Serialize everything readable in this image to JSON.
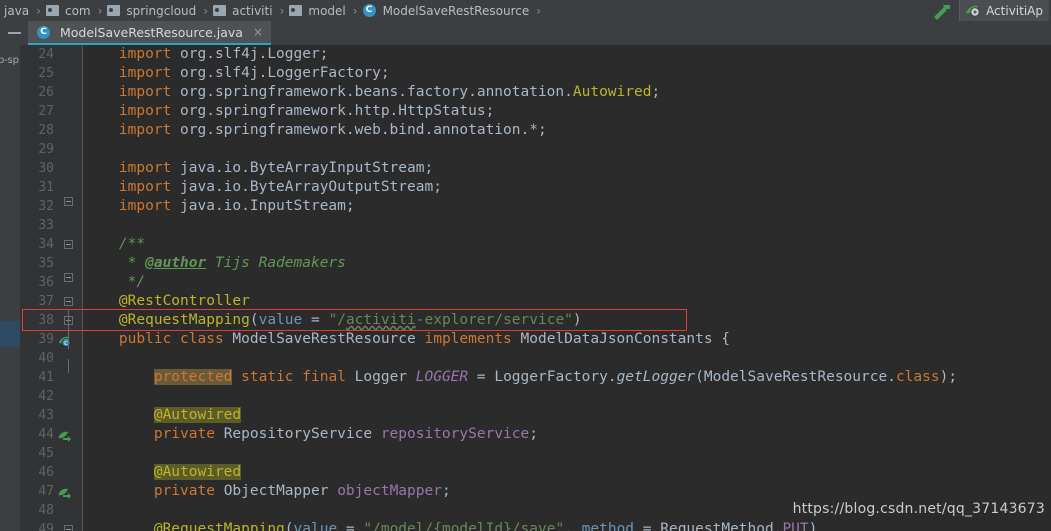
{
  "window": {
    "theme_bg": "#2b2b2b",
    "chrome_bg": "#3c3f41",
    "accent": "#2aa5c4"
  },
  "navbar": {
    "crumbs": [
      {
        "label": "java",
        "icon": "none"
      },
      {
        "label": "com",
        "icon": "folder-icon"
      },
      {
        "label": "springcloud",
        "icon": "folder-icon"
      },
      {
        "label": "activiti",
        "icon": "folder-icon"
      },
      {
        "label": "model",
        "icon": "folder-icon"
      },
      {
        "label": "ModelSaveRestResource",
        "icon": "class-icon"
      }
    ],
    "separator": "›",
    "build_icon": "hammer-icon",
    "run_config": {
      "label": "ActivitiAp",
      "icon": "run-config-icon"
    }
  },
  "tabbar": {
    "collapse_label": "—",
    "tabs": [
      {
        "label": "ModelSaveRestResource.java",
        "icon": "class-icon",
        "close": "×",
        "active": true
      }
    ]
  },
  "toolstrip": {
    "label": "p-sp"
  },
  "editor": {
    "first_line": 24,
    "lines": [
      {
        "n": 24,
        "tokens": [
          {
            "t": "    ",
            "c": "plain"
          },
          {
            "t": "import ",
            "c": "kw"
          },
          {
            "t": "org.slf4j.Logger;",
            "c": "plain"
          }
        ]
      },
      {
        "n": 25,
        "tokens": [
          {
            "t": "    ",
            "c": "plain"
          },
          {
            "t": "import ",
            "c": "kw"
          },
          {
            "t": "org.slf4j.LoggerFactory;",
            "c": "plain"
          }
        ]
      },
      {
        "n": 26,
        "tokens": [
          {
            "t": "    ",
            "c": "plain"
          },
          {
            "t": "import ",
            "c": "kw"
          },
          {
            "t": "org.springframework.beans.factory.annotation.",
            "c": "plain"
          },
          {
            "t": "Autowired",
            "c": "ann"
          },
          {
            "t": ";",
            "c": "plain"
          }
        ]
      },
      {
        "n": 27,
        "tokens": [
          {
            "t": "    ",
            "c": "plain"
          },
          {
            "t": "import ",
            "c": "kw"
          },
          {
            "t": "org.springframework.http.HttpStatus;",
            "c": "plain"
          }
        ]
      },
      {
        "n": 28,
        "tokens": [
          {
            "t": "    ",
            "c": "plain"
          },
          {
            "t": "import ",
            "c": "kw"
          },
          {
            "t": "org.springframework.web.bind.annotation.*;",
            "c": "plain"
          }
        ]
      },
      {
        "n": 29,
        "tokens": []
      },
      {
        "n": 30,
        "tokens": [
          {
            "t": "    ",
            "c": "plain"
          },
          {
            "t": "import ",
            "c": "kw"
          },
          {
            "t": "java.io.ByteArrayInputStream;",
            "c": "plain"
          }
        ]
      },
      {
        "n": 31,
        "tokens": [
          {
            "t": "    ",
            "c": "plain"
          },
          {
            "t": "import ",
            "c": "kw"
          },
          {
            "t": "java.io.ByteArrayOutputStream;",
            "c": "plain"
          }
        ]
      },
      {
        "n": 32,
        "tokens": [
          {
            "t": "    ",
            "c": "plain"
          },
          {
            "t": "import ",
            "c": "kw"
          },
          {
            "t": "java.io.InputStream;",
            "c": "plain"
          }
        ]
      },
      {
        "n": 33,
        "tokens": []
      },
      {
        "n": 34,
        "tokens": [
          {
            "t": "    ",
            "c": "plain"
          },
          {
            "t": "/**",
            "c": "cmtdoc"
          }
        ]
      },
      {
        "n": 35,
        "tokens": [
          {
            "t": "     * ",
            "c": "cmtdoc"
          },
          {
            "t": "@author",
            "c": "tagdoc"
          },
          {
            "t": " Tijs Rademakers",
            "c": "cmtdoc"
          }
        ]
      },
      {
        "n": 36,
        "tokens": [
          {
            "t": "     */",
            "c": "cmtdoc"
          }
        ]
      },
      {
        "n": 37,
        "tokens": [
          {
            "t": "    ",
            "c": "plain"
          },
          {
            "t": "@RestController",
            "c": "ann"
          }
        ]
      },
      {
        "n": 38,
        "tokens": [
          {
            "t": "    ",
            "c": "plain"
          },
          {
            "t": "@RequestMapping",
            "c": "ann"
          },
          {
            "t": "(",
            "c": "plain"
          },
          {
            "t": "value",
            "c": "num"
          },
          {
            "t": " = ",
            "c": "plain"
          },
          {
            "t": "\"/",
            "c": "str"
          },
          {
            "t": "activiti",
            "c": "typo"
          },
          {
            "t": "-explorer/service\"",
            "c": "str"
          },
          {
            "t": ")",
            "c": "plain"
          }
        ]
      },
      {
        "n": 39,
        "tokens": [
          {
            "t": "    ",
            "c": "plain"
          },
          {
            "t": "public class ",
            "c": "kw"
          },
          {
            "t": "ModelSaveRestResource ",
            "c": "plain"
          },
          {
            "t": "implements ",
            "c": "kw"
          },
          {
            "t": "ModelDataJsonConstants {",
            "c": "plain"
          }
        ]
      },
      {
        "n": 40,
        "tokens": []
      },
      {
        "n": 41,
        "tokens": [
          {
            "t": "        ",
            "c": "plain"
          },
          {
            "t": "protected",
            "c": "srchhl"
          },
          {
            "t": " ",
            "c": "plain"
          },
          {
            "t": "static final ",
            "c": "kw"
          },
          {
            "t": "Logger ",
            "c": "plain"
          },
          {
            "t": "LOGGER",
            "c": "constf"
          },
          {
            "t": " = LoggerFactory.",
            "c": "plain"
          },
          {
            "t": "getLogger",
            "c": "meth"
          },
          {
            "t": "(ModelSaveRestResource.",
            "c": "plain"
          },
          {
            "t": "class",
            "c": "kw"
          },
          {
            "t": ");",
            "c": "plain"
          }
        ]
      },
      {
        "n": 42,
        "tokens": []
      },
      {
        "n": 43,
        "tokens": [
          {
            "t": "        ",
            "c": "plain"
          },
          {
            "t": "@Autowired",
            "c": "annhl"
          }
        ]
      },
      {
        "n": 44,
        "tokens": [
          {
            "t": "        ",
            "c": "plain"
          },
          {
            "t": "private ",
            "c": "kw"
          },
          {
            "t": "RepositoryService ",
            "c": "plain"
          },
          {
            "t": "repositoryService",
            "c": "field"
          },
          {
            "t": ";",
            "c": "plain"
          }
        ]
      },
      {
        "n": 45,
        "tokens": []
      },
      {
        "n": 46,
        "tokens": [
          {
            "t": "        ",
            "c": "plain"
          },
          {
            "t": "@Autowired",
            "c": "annhl"
          }
        ]
      },
      {
        "n": 47,
        "tokens": [
          {
            "t": "        ",
            "c": "plain"
          },
          {
            "t": "private ",
            "c": "kw"
          },
          {
            "t": "ObjectMapper ",
            "c": "plain"
          },
          {
            "t": "objectMapper",
            "c": "field"
          },
          {
            "t": ";",
            "c": "plain"
          }
        ]
      },
      {
        "n": 48,
        "tokens": []
      },
      {
        "n": 49,
        "tokens": [
          {
            "t": "        ",
            "c": "plain"
          },
          {
            "t": "@RequestMapping",
            "c": "ann"
          },
          {
            "t": "(",
            "c": "plain"
          },
          {
            "t": "value",
            "c": "num"
          },
          {
            "t": " = ",
            "c": "plain"
          },
          {
            "t": "\"/model/{modelId}/save\"",
            "c": "str"
          },
          {
            "t": ", ",
            "c": "plain"
          },
          {
            "t": "method",
            "c": "num"
          },
          {
            "t": " = RequestMethod.",
            "c": "plain"
          },
          {
            "t": "PUT",
            "c": "field"
          },
          {
            "t": ")",
            "c": "plain"
          }
        ]
      }
    ],
    "gutter_icons": [
      {
        "line": 39,
        "icon": "class-override-icon"
      },
      {
        "line": 44,
        "icon": "bean-injection-icon"
      },
      {
        "line": 47,
        "icon": "bean-injection-icon"
      }
    ],
    "fold_markers": [
      {
        "line": 32,
        "type": "collapse-end"
      },
      {
        "line": 34,
        "type": "collapse-start"
      },
      {
        "line": 36,
        "type": "collapse-end"
      },
      {
        "line": 37,
        "type": "collapse-start"
      },
      {
        "line": 38,
        "type": "collapse-start"
      },
      {
        "line": 49,
        "type": "collapse-start"
      }
    ]
  },
  "annotation": {
    "highlight_color": "#e23a3a",
    "target_line": 38,
    "target_text": "@RequestMapping(value = \"/activiti-explorer/service\")"
  },
  "watermark": {
    "text": "https://blog.csdn.net/qq_37143673"
  }
}
